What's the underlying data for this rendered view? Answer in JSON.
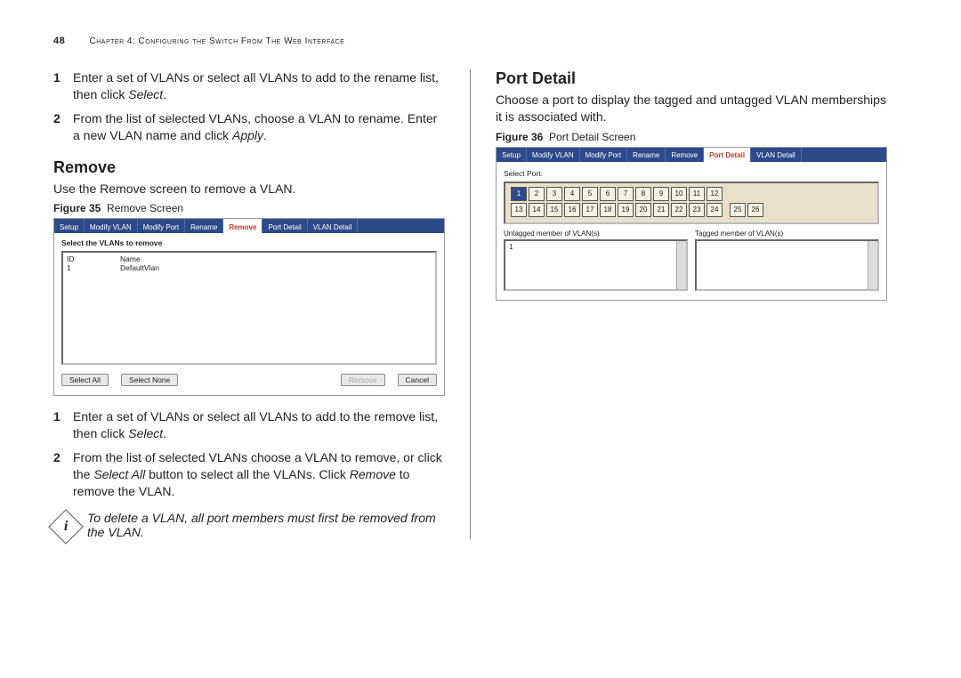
{
  "header": {
    "page_number": "48",
    "chapter": "Chapter 4: Configuring the Switch From The Web Interface"
  },
  "left": {
    "step1": "Enter a set of VLANs or select all VLANs to add to the rename list, then click ",
    "step1_em": "Select",
    "step1_end": ".",
    "step2": "From the list of selected VLANs, choose a VLAN to rename. Enter a new VLAN name and click ",
    "step2_em": "Apply",
    "step2_end": ".",
    "remove_heading": "Remove",
    "remove_body": "Use the Remove screen to remove a VLAN.",
    "fig35_label": "Figure 35",
    "fig35_title": "Remove Screen",
    "tabs": [
      "Setup",
      "Modify VLAN",
      "Modify Port",
      "Rename",
      "Remove",
      "Port Detail",
      "VLAN Detail"
    ],
    "active_tab": "Remove",
    "fig35_instr": "Select the VLANs to remove",
    "fig35_hdr_id": "ID",
    "fig35_hdr_name": "Name",
    "fig35_row_id": "1",
    "fig35_row_name": "DefaultVlan",
    "btn_selectall": "Select All",
    "btn_selectnone": "Select None",
    "btn_remove": "Remove",
    "btn_cancel": "Cancel",
    "post1": "Enter a set of VLANs or select all VLANs to add to the remove list, then click ",
    "post1_em": "Select",
    "post1_end": ".",
    "post2a": "From the list of selected VLANs choose a VLAN to remove, or click the ",
    "post2_em1": "Select All",
    "post2b": " button to select all the VLANs. Click ",
    "post2_em2": "Remove",
    "post2c": " to remove the VLAN.",
    "note": "To delete a VLAN, all port members must first be removed from the VLAN."
  },
  "right": {
    "heading": "Port Detail",
    "body": "Choose a port to display the tagged and untagged VLAN memberships it is associated with.",
    "fig36_label": "Figure 36",
    "fig36_title": "Port Detail Screen",
    "tabs": [
      "Setup",
      "Modify VLAN",
      "Modify Port",
      "Rename",
      "Remove",
      "Port Detail",
      "VLAN Detail"
    ],
    "active_tab": "Port Detail",
    "selport": "Select Port:",
    "ports_row1": [
      "1",
      "2",
      "3",
      "4",
      "5",
      "6",
      "7",
      "8",
      "9",
      "10",
      "11",
      "12"
    ],
    "ports_row2": [
      "13",
      "14",
      "15",
      "16",
      "17",
      "18",
      "19",
      "20",
      "21",
      "22",
      "23",
      "24",
      "",
      "25",
      "26"
    ],
    "untagged_label": "Untagged member of VLAN(s)",
    "tagged_label": "Tagged member of VLAN(s)",
    "untagged_val": "1"
  }
}
